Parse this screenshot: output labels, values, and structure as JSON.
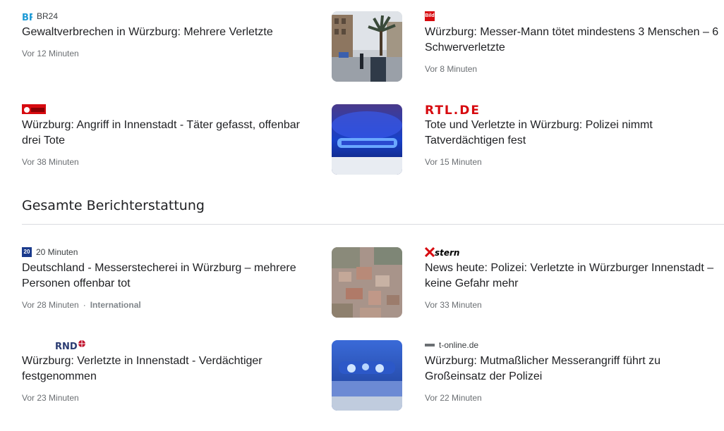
{
  "top": {
    "articles": [
      {
        "source": "BR24",
        "title": "Gewaltverbrechen in Würzburg: Mehrere Verletzte",
        "time": "Vor 12 Minuten"
      },
      {
        "source": "Bild",
        "title": "Würzburg: Messer-Mann tötet mindestens 3 Menschen – 6 Schwerverletzte",
        "time": "Vor 8 Minuten"
      },
      {
        "source": "ONLINE FOCUS",
        "title": "Würzburg: Angriff in Innenstadt - Täter gefasst, offenbar drei Tote",
        "time": "Vor 38 Minuten"
      },
      {
        "source": "RTL.DE",
        "title": "Tote und Verletzte in Würzburg: Polizei nimmt Tatverdächtigen fest",
        "time": "Vor 15 Minuten"
      }
    ]
  },
  "section": {
    "title": "Gesamte Berichterstattung"
  },
  "coverage": {
    "articles": [
      {
        "source": "20 Minuten",
        "title": "Deutschland - Messerstecherei in Würzburg – mehrere Personen offenbar tot",
        "time": "Vor 28 Minuten",
        "tag": "International"
      },
      {
        "source": "stern",
        "title": "News heute: Polizei: Verletzte in Würzburger Innenstadt – keine Gefahr mehr",
        "time": "Vor 33 Minuten"
      },
      {
        "source": "RND",
        "title": "Würzburg: Verletzte in Innenstadt - Verdächtiger festgenommen",
        "time": "Vor 23 Minuten"
      },
      {
        "source": "t-online.de",
        "title": "Würzburg: Mutmaßlicher Messerangriff führt zu Großeinsatz der Polizei",
        "time": "Vor 22 Minuten"
      }
    ]
  },
  "colors": {
    "accent_red": "#d70a0f",
    "br_blue": "#1d9ad6",
    "rnd_navy": "#2b3c72"
  }
}
